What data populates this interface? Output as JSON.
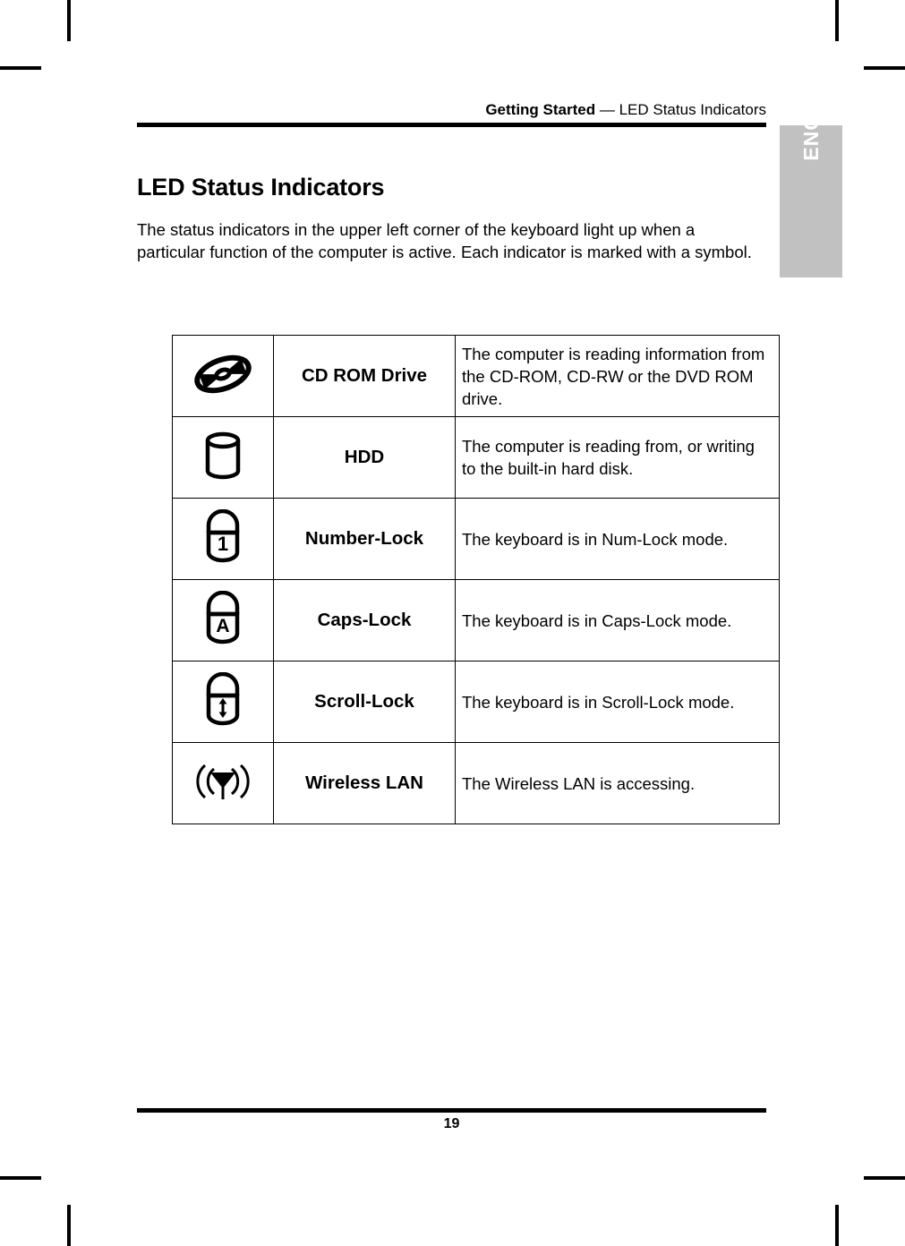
{
  "header": {
    "breadcrumb_strong": "Getting Started",
    "breadcrumb_separator": " — ",
    "breadcrumb_rest": "LED Status Indicators"
  },
  "language_tab": {
    "label": "ENGLISH",
    "background_color": "#c1c1c1",
    "text_color": "#ffffff"
  },
  "section": {
    "title": "LED Status Indicators",
    "intro": "The status indicators in the upper left corner of the keyboard light up when a particular function of the computer is active. Each indicator is marked with a symbol."
  },
  "table": {
    "rows": [
      {
        "icon": "cd-rom-disc-icon",
        "name": "CD ROM Drive",
        "description": "The computer is reading information from the CD-ROM, CD-RW or the DVD ROM drive."
      },
      {
        "icon": "hard-disk-cylinder-icon",
        "name": "HDD",
        "description": "The computer is reading from, or writing to the built-in hard disk."
      },
      {
        "icon": "padlock-number-lock-icon",
        "name": "Number-Lock",
        "description": "The keyboard is in Num-Lock mode.",
        "glyph": "1"
      },
      {
        "icon": "padlock-caps-lock-icon",
        "name": "Caps-Lock",
        "description": "The keyboard is in Caps-Lock mode.",
        "glyph": "A"
      },
      {
        "icon": "padlock-scroll-lock-icon",
        "name": "Scroll-Lock",
        "description": "The keyboard is in Scroll-Lock mode.",
        "glyph": "↕"
      },
      {
        "icon": "wireless-lan-antenna-icon",
        "name": "Wireless LAN",
        "description": "The Wireless LAN is accessing."
      }
    ]
  },
  "footer": {
    "page_number": "19"
  }
}
